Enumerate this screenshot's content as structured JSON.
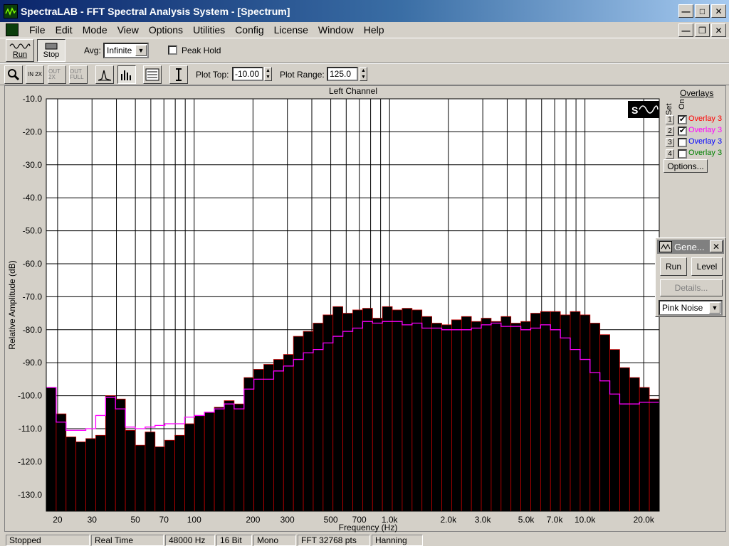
{
  "window": {
    "title": "SpectraLAB - FFT Spectral Analysis System - [Spectrum]"
  },
  "menu": [
    "File",
    "Edit",
    "Mode",
    "View",
    "Options",
    "Utilities",
    "Config",
    "License",
    "Window",
    "Help"
  ],
  "toolbar": {
    "run_label": "Run",
    "stop_label": "Stop",
    "avg_label": "Avg:",
    "avg_value": "Infinite",
    "peak_hold_label": "Peak Hold",
    "zoom_in_label": "IN 2X",
    "zoom_out_label": "OUT 2X",
    "zoom_full_label": "OUT FULL",
    "plot_top_label": "Plot Top:",
    "plot_top_value": "-10.00",
    "plot_range_label": "Plot Range:",
    "plot_range_value": "125.0"
  },
  "overlays": {
    "title": "Overlays",
    "set_label": "Set",
    "on_label": "On",
    "items": [
      {
        "num": "1",
        "label": "Overlay 3",
        "checked": true,
        "color": "#ff0000"
      },
      {
        "num": "2",
        "label": "Overlay 3",
        "checked": true,
        "color": "#ff00ff"
      },
      {
        "num": "3",
        "label": "Overlay 3",
        "checked": false,
        "color": "#0000ff"
      },
      {
        "num": "4",
        "label": "Overlay 3",
        "checked": false,
        "color": "#008000"
      }
    ],
    "options_label": "Options..."
  },
  "generator": {
    "title": "Gene...",
    "run_label": "Run",
    "level_label": "Level",
    "details_label": "Details...",
    "signal_value": "Pink Noise"
  },
  "chart_data": {
    "type": "bar",
    "title": "Left Channel",
    "xlabel": "Frequency (Hz)",
    "ylabel": "Relative Amplitude (dB)",
    "xscale": "log",
    "xlim": [
      17.5,
      24000
    ],
    "ylim": [
      -135,
      -10
    ],
    "y_ticks": [
      -10,
      -20,
      -30,
      -40,
      -50,
      -60,
      -70,
      -80,
      -90,
      -100,
      -110,
      -120,
      -130
    ],
    "x_tick_labels": [
      {
        "value": 20,
        "label": "20"
      },
      {
        "value": 30,
        "label": "30"
      },
      {
        "value": 50,
        "label": "50"
      },
      {
        "value": 70,
        "label": "70"
      },
      {
        "value": 100,
        "label": "100"
      },
      {
        "value": 200,
        "label": "200"
      },
      {
        "value": 300,
        "label": "300"
      },
      {
        "value": 500,
        "label": "500"
      },
      {
        "value": 700,
        "label": "700"
      },
      {
        "value": 1000,
        "label": "1.0k"
      },
      {
        "value": 2000,
        "label": "2.0k"
      },
      {
        "value": 3000,
        "label": "3.0k"
      },
      {
        "value": 5000,
        "label": "5.0k"
      },
      {
        "value": 7000,
        "label": "7.0k"
      },
      {
        "value": 10000,
        "label": "10.0k"
      },
      {
        "value": 20000,
        "label": "20.0k"
      }
    ],
    "grid": true,
    "bar_color": "#000000",
    "bar_edge_color": "#c00000",
    "overlay_color": "#ff00ff",
    "bars": [
      -97.5,
      -105.5,
      -112.5,
      -114,
      -113,
      -112,
      -100,
      -101,
      -110.5,
      -115,
      -111,
      -115.5,
      -113.5,
      -112,
      -108.5,
      -106,
      -105,
      -103.5,
      -101.5,
      -102.5,
      -94.5,
      -92,
      -90.5,
      -89,
      -87.5,
      -82,
      -80.5,
      -78,
      -75.5,
      -73,
      -75,
      -74,
      -73.5,
      -76.5,
      -73,
      -74,
      -73.5,
      -74,
      -76,
      -78,
      -78.5,
      -77,
      -76,
      -77.5,
      -76.5,
      -77.5,
      -76,
      -78,
      -77.5,
      -75,
      -74.5,
      -74.5,
      -75.5,
      -74.5,
      -75.5,
      -78,
      -81.5,
      -86,
      -91.5,
      -94.5,
      -97.5,
      -101
    ],
    "overlay": [
      -97.5,
      -108,
      -110.5,
      -110.5,
      -110,
      -106,
      -100.5,
      -104,
      -109.5,
      -110,
      -109.5,
      -109,
      -108.5,
      -108.5,
      -106.5,
      -106,
      -105,
      -104,
      -102.5,
      -104,
      -98,
      -95,
      -95,
      -92.5,
      -91,
      -89,
      -87,
      -86,
      -84,
      -82,
      -80.5,
      -79.5,
      -77.5,
      -78,
      -77.5,
      -77.5,
      -78.5,
      -78,
      -79.5,
      -79.5,
      -80,
      -80,
      -80,
      -79.5,
      -78.5,
      -78,
      -79,
      -79,
      -80,
      -79.5,
      -78.5,
      -80,
      -82.5,
      -86,
      -89,
      -93,
      -95.5,
      -99.5,
      -102.5,
      -102.5,
      -102,
      -102
    ]
  },
  "status": [
    "Stopped",
    "Real Time",
    "48000 Hz",
    "16 Bit",
    "Mono",
    "FFT 32768 pts",
    "Hanning"
  ]
}
